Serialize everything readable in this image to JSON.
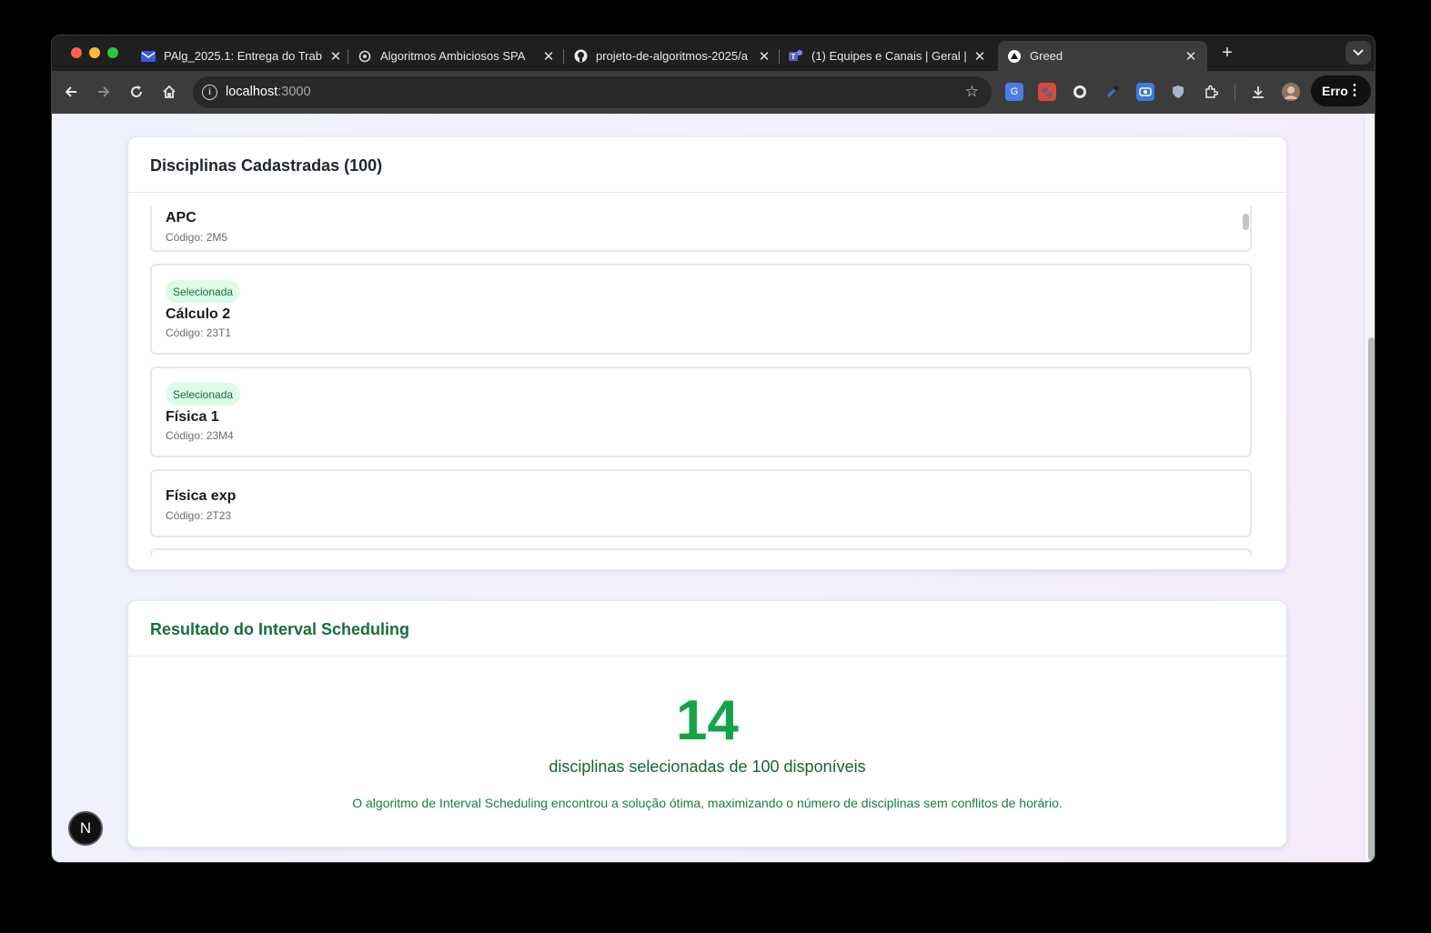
{
  "browser": {
    "tabs": [
      {
        "title": "PAlg_2025.1: Entrega do Trab",
        "favicon": "envelope-icon",
        "active": false
      },
      {
        "title": "Algoritmos Ambiciosos SPA",
        "favicon": "openai-icon",
        "active": false
      },
      {
        "title": "projeto-de-algoritmos-2025/a",
        "favicon": "github-icon",
        "active": false
      },
      {
        "title": "(1) Equipes e Canais | Geral | I",
        "favicon": "teams-icon",
        "active": false
      },
      {
        "title": "Greed",
        "favicon": "triangle-icon",
        "active": true
      }
    ],
    "url_host": "localhost",
    "url_port": ":3000",
    "profile_button_label": "Erro"
  },
  "disciplinas": {
    "header": "Disciplinas Cadastradas (100)",
    "items": [
      {
        "name": "APC",
        "code": "Código: 2M5",
        "selected": false
      },
      {
        "name": "Cálculo 2",
        "code": "Código: 23T1",
        "selected": true,
        "badge": "Selecionada"
      },
      {
        "name": "Física 1",
        "code": "Código: 23M4",
        "selected": true,
        "badge": "Selecionada"
      },
      {
        "name": "Física exp",
        "code": "Código: 2T23",
        "selected": false
      }
    ]
  },
  "resultado": {
    "header": "Resultado do Interval Scheduling",
    "count": "14",
    "subline": "disciplinas selecionadas de 100 disponíveis",
    "explanation": "O algoritmo de Interval Scheduling encontrou a solução ótima, maximizando o número de disciplinas sem conflitos de horário."
  },
  "dev_badge": "N",
  "colors": {
    "accent_green": "#16a34a",
    "badge_bg": "#dcfce7",
    "browser_dark": "#1f1f1f"
  }
}
